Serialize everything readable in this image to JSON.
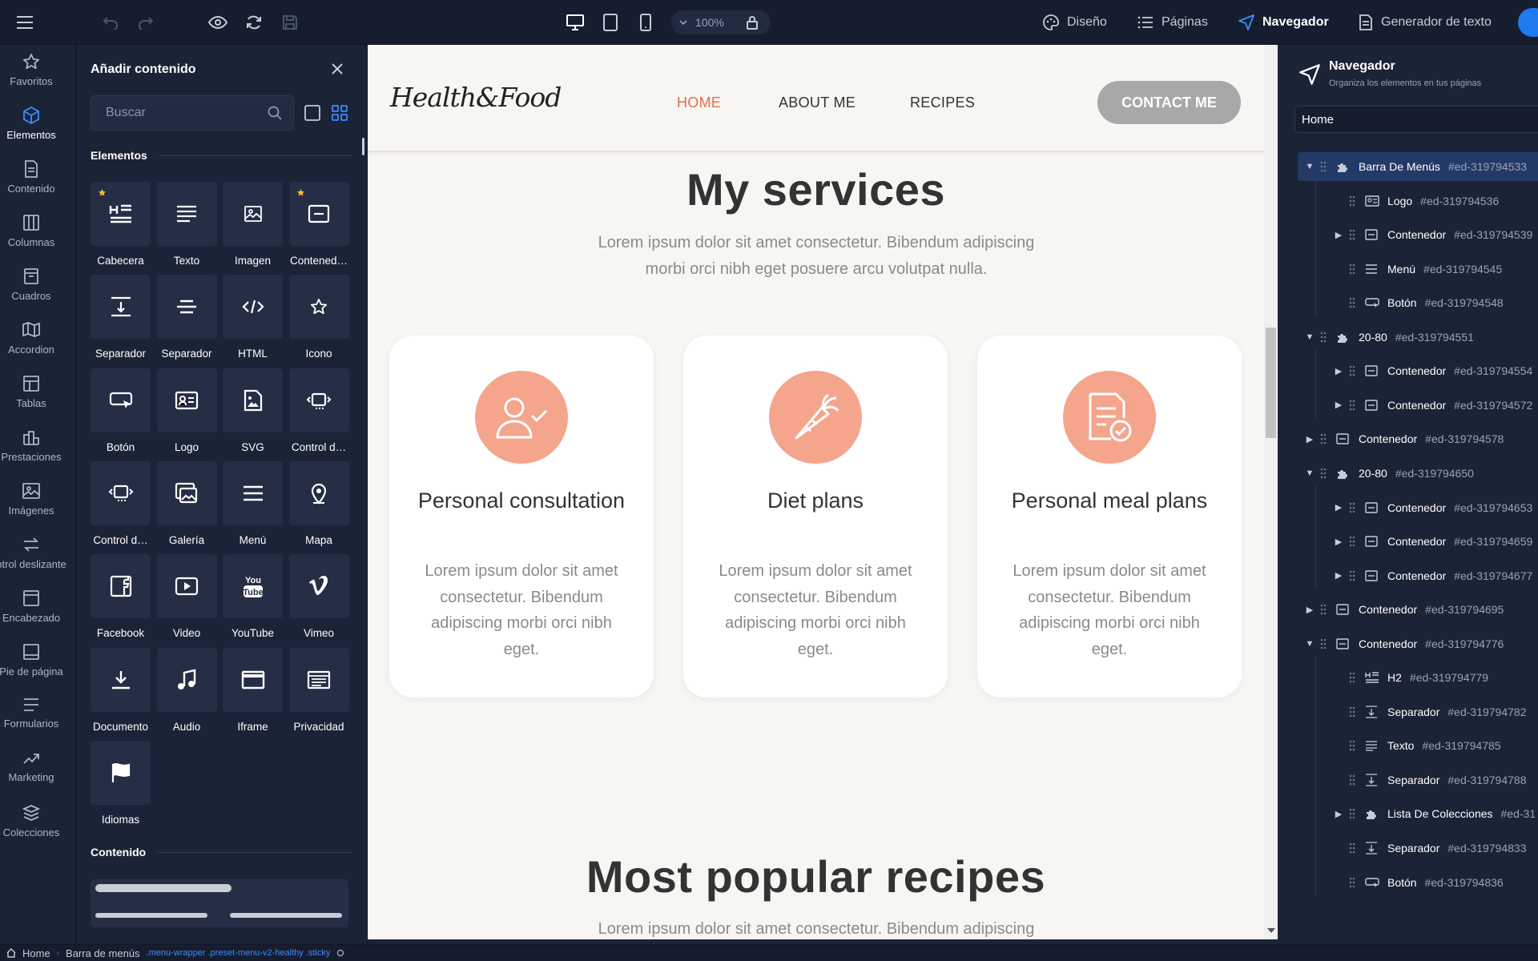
{
  "topbar": {
    "zoom": "100%",
    "nav": [
      {
        "label": "Diseño",
        "icon": "palette-icon"
      },
      {
        "label": "Páginas",
        "icon": "list-icon"
      },
      {
        "label": "Navegador",
        "icon": "navigator-icon",
        "active": true
      },
      {
        "label": "Generador de texto",
        "icon": "document-icon"
      }
    ]
  },
  "rail": [
    {
      "label": "Favoritos",
      "icon": "star-icon"
    },
    {
      "label": "Elementos",
      "icon": "cube-icon",
      "active": true
    },
    {
      "label": "Contenido",
      "icon": "file-icon"
    },
    {
      "label": "Columnas",
      "icon": "columns-icon"
    },
    {
      "label": "Cuadros",
      "icon": "box-icon"
    },
    {
      "label": "Accordion",
      "icon": "accordion-icon"
    },
    {
      "label": "Tablas",
      "icon": "table-icon"
    },
    {
      "label": "Prestaciones",
      "icon": "features-icon"
    },
    {
      "label": "Imágenes",
      "icon": "image-icon"
    },
    {
      "label": "ntrol deslizante",
      "icon": "slider-icon"
    },
    {
      "label": "Encabezado",
      "icon": "header-icon"
    },
    {
      "label": "Pie de página",
      "icon": "footer-icon"
    },
    {
      "label": "Formularios",
      "icon": "form-icon"
    },
    {
      "label": "Marketing",
      "icon": "trend-icon"
    },
    {
      "label": "Colecciones",
      "icon": "layers-icon"
    }
  ],
  "add_panel": {
    "title": "Añadir contenido",
    "search_placeholder": "Buscar",
    "section_elements": "Elementos",
    "section_content": "Contenido",
    "elements": [
      {
        "label": "Cabecera",
        "icon": "heading-icon",
        "star": true
      },
      {
        "label": "Texto",
        "icon": "text-icon"
      },
      {
        "label": "Imagen",
        "icon": "image-icon"
      },
      {
        "label": "Contened…",
        "icon": "container-icon",
        "star": true
      },
      {
        "label": "Separador",
        "icon": "separator-space-icon"
      },
      {
        "label": "Separador",
        "icon": "separator-line-icon"
      },
      {
        "label": "HTML",
        "icon": "code-icon"
      },
      {
        "label": "Icono",
        "icon": "star-icon"
      },
      {
        "label": "Botón",
        "icon": "button-icon"
      },
      {
        "label": "Logo",
        "icon": "logo-icon"
      },
      {
        "label": "SVG",
        "icon": "svg-icon"
      },
      {
        "label": "Control d…",
        "icon": "slider-control-icon"
      },
      {
        "label": "Control d…",
        "icon": "carousel-control-icon"
      },
      {
        "label": "Galería",
        "icon": "gallery-icon"
      },
      {
        "label": "Menú",
        "icon": "menu-icon"
      },
      {
        "label": "Mapa",
        "icon": "map-pin-icon"
      },
      {
        "label": "Facebook",
        "icon": "facebook-icon"
      },
      {
        "label": "Video",
        "icon": "video-icon"
      },
      {
        "label": "YouTube",
        "icon": "youtube-icon"
      },
      {
        "label": "Vimeo",
        "icon": "vimeo-icon"
      },
      {
        "label": "Documento",
        "icon": "download-icon"
      },
      {
        "label": "Audio",
        "icon": "music-icon"
      },
      {
        "label": "Iframe",
        "icon": "iframe-icon"
      },
      {
        "label": "Privacidad",
        "icon": "privacy-icon"
      },
      {
        "label": "Idiomas",
        "icon": "flag-icon"
      }
    ]
  },
  "site": {
    "logo_text": "Health&Food",
    "nav": [
      "HOME",
      "ABOUT ME",
      "RECIPES"
    ],
    "contact_label": "CONTACT ME",
    "services_title": "My services",
    "services_text": "Lorem ipsum dolor sit amet consectetur. Bibendum adipiscing morbi orci nibh eget posuere arcu volutpat nulla.",
    "cards": [
      {
        "title": "Personal consultation",
        "text": "Lorem ipsum dolor sit amet consectetur. Bibendum adipiscing morbi orci nibh eget.",
        "icon": "user-check-icon"
      },
      {
        "title": "Diet plans",
        "text": "Lorem ipsum dolor sit amet consectetur. Bibendum adipiscing morbi orci nibh eget.",
        "icon": "carrot-icon"
      },
      {
        "title": "Personal meal plans",
        "text": "Lorem ipsum dolor sit amet consectetur. Bibendum adipiscing morbi orci nibh eget.",
        "icon": "document-check-icon"
      }
    ],
    "recipes_title": "Most popular recipes",
    "recipes_text": "Lorem ipsum dolor sit amet consectetur. Bibendum adipiscing"
  },
  "navigator": {
    "title": "Navegador",
    "subtitle": "Organiza los elementos en tus páginas",
    "page": "Home",
    "tree": [
      {
        "name": "Barra De Menús",
        "id": "#ed-319794533",
        "depth": 0,
        "toggle": "open",
        "icon": "puzzle-icon",
        "selected": true
      },
      {
        "name": "Logo",
        "id": "#ed-319794536",
        "depth": 1,
        "toggle": "none",
        "icon": "logo-icon"
      },
      {
        "name": "Contenedor",
        "id": "#ed-319794539",
        "depth": 1,
        "toggle": "closed",
        "icon": "container-icon"
      },
      {
        "name": "Menú",
        "id": "#ed-319794545",
        "depth": 1,
        "toggle": "none",
        "icon": "menu-icon"
      },
      {
        "name": "Botón",
        "id": "#ed-319794548",
        "depth": 1,
        "toggle": "none",
        "icon": "button-icon"
      },
      {
        "name": "20-80",
        "id": "#ed-319794551",
        "depth": 0,
        "toggle": "open",
        "icon": "puzzle-icon"
      },
      {
        "name": "Contenedor",
        "id": "#ed-319794554",
        "depth": 1,
        "toggle": "closed",
        "icon": "container-icon"
      },
      {
        "name": "Contenedor",
        "id": "#ed-319794572",
        "depth": 1,
        "toggle": "closed",
        "icon": "container-icon"
      },
      {
        "name": "Contenedor",
        "id": "#ed-319794578",
        "depth": 0,
        "toggle": "closed",
        "icon": "container-icon"
      },
      {
        "name": "20-80",
        "id": "#ed-319794650",
        "depth": 0,
        "toggle": "open",
        "icon": "puzzle-icon"
      },
      {
        "name": "Contenedor",
        "id": "#ed-319794653",
        "depth": 1,
        "toggle": "closed",
        "icon": "container-icon"
      },
      {
        "name": "Contenedor",
        "id": "#ed-319794659",
        "depth": 1,
        "toggle": "closed",
        "icon": "container-icon"
      },
      {
        "name": "Contenedor",
        "id": "#ed-319794677",
        "depth": 1,
        "toggle": "closed",
        "icon": "container-icon"
      },
      {
        "name": "Contenedor",
        "id": "#ed-319794695",
        "depth": 0,
        "toggle": "closed",
        "icon": "container-icon"
      },
      {
        "name": "Contenedor",
        "id": "#ed-319794776",
        "depth": 0,
        "toggle": "open",
        "icon": "container-icon"
      },
      {
        "name": "H2",
        "id": "#ed-319794779",
        "depth": 1,
        "toggle": "none",
        "icon": "heading-icon"
      },
      {
        "name": "Separador",
        "id": "#ed-319794782",
        "depth": 1,
        "toggle": "none",
        "icon": "separator-space-icon"
      },
      {
        "name": "Texto",
        "id": "#ed-319794785",
        "depth": 1,
        "toggle": "none",
        "icon": "text-icon"
      },
      {
        "name": "Separador",
        "id": "#ed-319794788",
        "depth": 1,
        "toggle": "none",
        "icon": "separator-space-icon"
      },
      {
        "name": "Lista De Colecciones",
        "id": "#ed-31",
        "depth": 1,
        "toggle": "closed",
        "icon": "puzzle-icon"
      },
      {
        "name": "Separador",
        "id": "#ed-319794833",
        "depth": 1,
        "toggle": "none",
        "icon": "separator-space-icon"
      },
      {
        "name": "Botón",
        "id": "#ed-319794836",
        "depth": 1,
        "toggle": "none",
        "icon": "button-icon"
      }
    ]
  },
  "statusbar": {
    "crumbs": [
      "Home",
      "Barra de menús"
    ],
    "classes": ".menu-wrapper .preset-menu-v2-healthy .sticky"
  }
}
